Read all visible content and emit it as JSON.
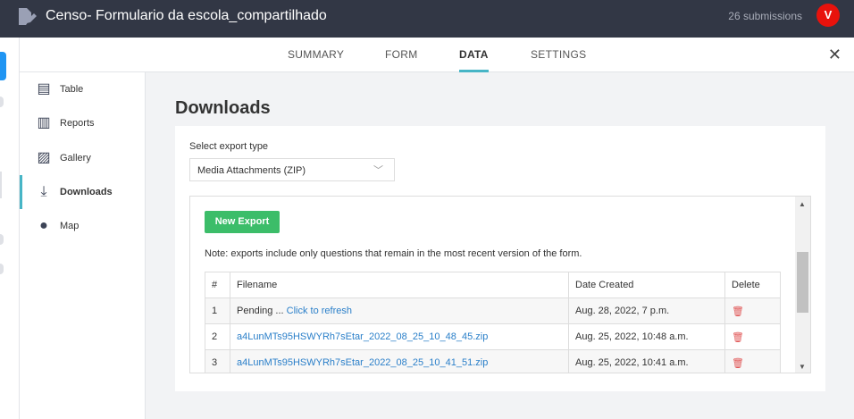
{
  "header": {
    "title": "Censo- Formulario da escola_compartilhado",
    "submissions": "26 submissions",
    "avatar": "V"
  },
  "tabs": [
    {
      "label": "SUMMARY"
    },
    {
      "label": "FORM"
    },
    {
      "label": "DATA"
    },
    {
      "label": "SETTINGS"
    }
  ],
  "close": "✕",
  "sidebar": {
    "items": [
      {
        "label": "Table",
        "icon": "table-icon"
      },
      {
        "label": "Reports",
        "icon": "reports-icon"
      },
      {
        "label": "Gallery",
        "icon": "gallery-icon"
      },
      {
        "label": "Downloads",
        "icon": "download-icon"
      },
      {
        "label": "Map",
        "icon": "map-pin-icon"
      }
    ]
  },
  "main": {
    "title": "Downloads",
    "export_label": "Select export type",
    "export_value": "Media Attachments (ZIP)",
    "new_export": "New Export",
    "note": "Note: exports include only questions that remain in the most recent version of the form.",
    "columns": [
      "#",
      "Filename",
      "Date Created",
      "Delete"
    ],
    "rows": [
      {
        "n": "1",
        "pending": "Pending ...",
        "link": "Click to refresh",
        "date": "Aug. 28, 2022, 7 p.m."
      },
      {
        "n": "2",
        "link": "a4LunMTs95HSWYRh7sEtar_2022_08_25_10_48_45.zip",
        "date": "Aug. 25, 2022, 10:48 a.m."
      },
      {
        "n": "3",
        "link": "a4LunMTs95HSWYRh7sEtar_2022_08_25_10_41_51.zip",
        "date": "Aug. 25, 2022, 10:41 a.m."
      }
    ]
  },
  "colors": {
    "topbar": "#323745",
    "accent": "#47b5c6",
    "new_export": "#3cbd69",
    "link": "#2a7fc9",
    "delete": "#e05555"
  }
}
